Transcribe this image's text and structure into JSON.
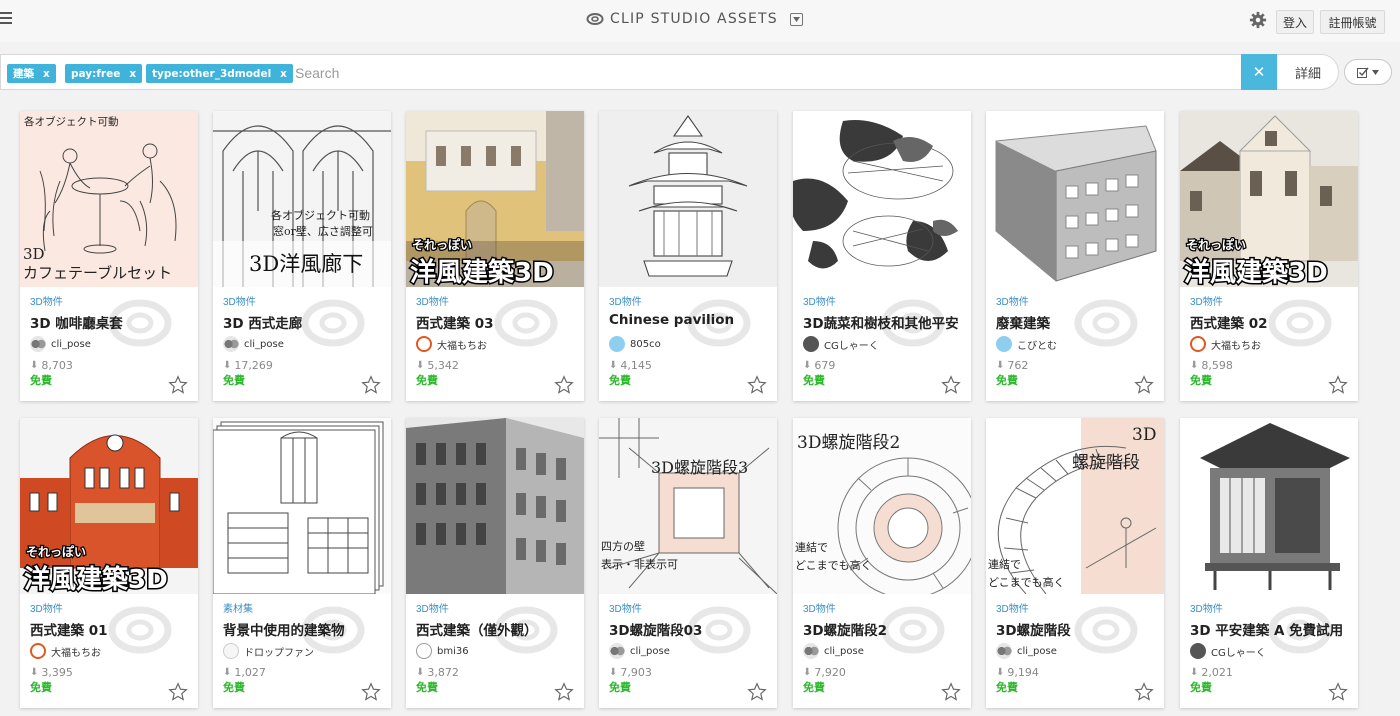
{
  "header": {
    "brand": "CLIP STUDIO ASSETS",
    "login_label": "登入",
    "signup_label": "註冊帳號"
  },
  "search": {
    "tags": [
      {
        "label": "建築",
        "remove": "x"
      },
      {
        "label": "pay:free",
        "remove": "x"
      },
      {
        "label": "type:other_3dmodel",
        "remove": "x"
      }
    ],
    "placeholder": "Search",
    "clear_label": "✕",
    "detail_label": "詳細"
  },
  "colors": {
    "accent": "#4ab7dd",
    "tag_bg": "#3fb3d9",
    "free": "#2eb82e",
    "category": "#3a8fc6"
  },
  "cards": [
    {
      "category": "3D物件",
      "title": "3D 咖啡廳桌套",
      "author": "cli_pose",
      "downloads": "8,703",
      "price": "免費",
      "thumb_text": [
        "各オブジェクト可動",
        "3D",
        "カフェテーブルセット"
      ]
    },
    {
      "category": "3D物件",
      "title": "3D 西式走廊",
      "author": "cli_pose",
      "downloads": "17,269",
      "price": "免費",
      "thumb_text": [
        "各オブジェクト可動",
        "窓or壁、広さ調整可",
        "3D洋風廊下"
      ]
    },
    {
      "category": "3D物件",
      "title": "西式建築 03",
      "author": "大福もちお",
      "downloads": "5,342",
      "price": "免費",
      "thumb_text": [
        "それっぽい",
        "洋風建築3D"
      ]
    },
    {
      "category": "3D物件",
      "title": "Chinese pavilion",
      "author": "805co",
      "downloads": "4,145",
      "price": "免費",
      "thumb_text": []
    },
    {
      "category": "3D物件",
      "title": "3D蔬菜和樹枝和其他平安",
      "author": "CGしゃーく",
      "downloads": "679",
      "price": "免費",
      "thumb_text": []
    },
    {
      "category": "3D物件",
      "title": "廢棄建築",
      "author": "こびとむ",
      "downloads": "762",
      "price": "免費",
      "thumb_text": []
    },
    {
      "category": "3D物件",
      "title": "西式建築 02",
      "author": "大福もちお",
      "downloads": "8,598",
      "price": "免費",
      "thumb_text": [
        "それっぽい",
        "洋風建築3D"
      ]
    },
    {
      "category": "3D物件",
      "title": "西式建築 01",
      "author": "大福もちお",
      "downloads": "3,395",
      "price": "免費",
      "thumb_text": [
        "それっぽい",
        "洋風建築3D"
      ]
    },
    {
      "category": "素材集",
      "title": "背景中使用的建築物",
      "author": "ドロップファン",
      "downloads": "1,027",
      "price": "免費",
      "thumb_text": []
    },
    {
      "category": "3D物件",
      "title": "西式建築（僅外觀）",
      "author": "bmi36",
      "downloads": "3,872",
      "price": "免費",
      "thumb_text": []
    },
    {
      "category": "3D物件",
      "title": "3D螺旋階段03",
      "author": "cli_pose",
      "downloads": "7,903",
      "price": "免費",
      "thumb_text": [
        "3D螺旋階段3",
        "四方の壁",
        "表示・非表示可"
      ]
    },
    {
      "category": "3D物件",
      "title": "3D螺旋階段2",
      "author": "cli_pose",
      "downloads": "7,920",
      "price": "免費",
      "thumb_text": [
        "3D螺旋階段2",
        "連結で",
        "どこまでも高く"
      ]
    },
    {
      "category": "3D物件",
      "title": "3D螺旋階段",
      "author": "cli_pose",
      "downloads": "9,194",
      "price": "免費",
      "thumb_text": [
        "3D",
        "螺旋階段",
        "連結で",
        "どこまでも高く"
      ]
    },
    {
      "category": "3D物件",
      "title": "3D 平安建築 A 免費試用",
      "author": "CGしゃーく",
      "downloads": "2,021",
      "price": "免費",
      "thumb_text": []
    }
  ]
}
